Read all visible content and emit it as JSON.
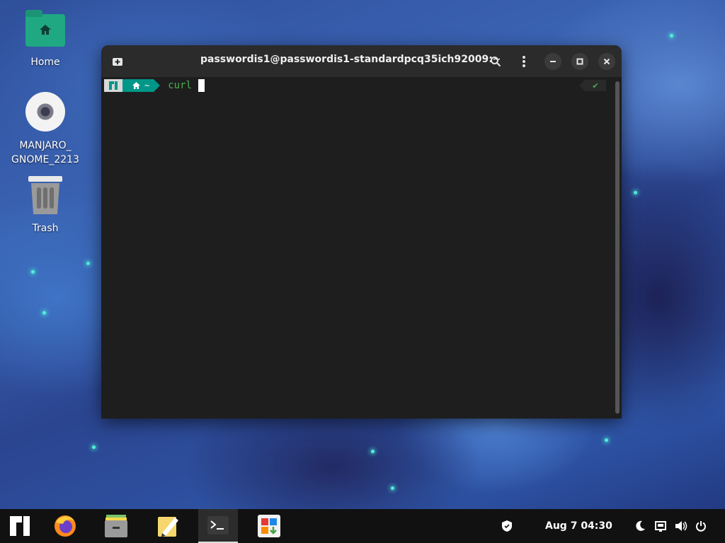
{
  "desktop": {
    "icons": [
      {
        "label": "Home",
        "icon": "folder-home-icon"
      },
      {
        "label": "MANJARO_ GNOME_2213",
        "icon": "optical-disc-icon"
      },
      {
        "label": "Trash",
        "icon": "trash-icon"
      }
    ]
  },
  "terminal": {
    "title": "passwordis1@passwordis1-standardpcq35ich92009:~",
    "prompt_dir": "~",
    "command": "curl",
    "status": "✔",
    "buttons": [
      "new-tab-icon",
      "search-icon",
      "menu-icon",
      "minimize-icon",
      "maximize-icon",
      "close-icon"
    ]
  },
  "taskbar": {
    "apps": [
      "manjaro-menu-icon",
      "firefox-icon",
      "file-manager-icon",
      "text-editor-icon",
      "terminal-icon",
      "software-center-icon"
    ],
    "active_app": "terminal-icon",
    "clock": "Aug 7  04:30",
    "tray": [
      "shield-icon",
      "night-light-icon",
      "network-icon",
      "volume-icon",
      "power-icon"
    ]
  },
  "colors": {
    "accent": "#009688",
    "command": "#4caf50",
    "folder": "#1fa882"
  }
}
